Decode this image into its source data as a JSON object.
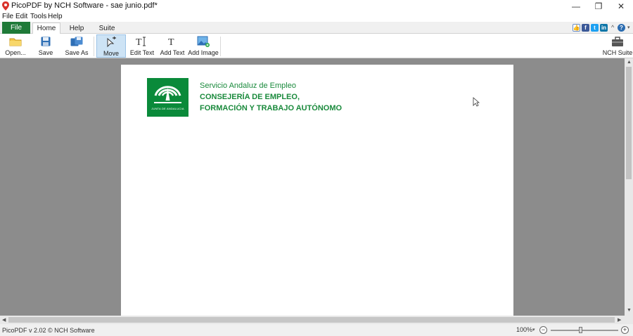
{
  "window": {
    "title": "PicoPDF by NCH Software - sae junio.pdf*"
  },
  "window_controls": {
    "minimize": "—",
    "restore": "❐",
    "close": "✕"
  },
  "menu": [
    "File",
    "Edit",
    "Tools",
    "Help"
  ],
  "tabs": [
    "File",
    "Home",
    "Help",
    "Suite"
  ],
  "toolbar": {
    "open": "Open...",
    "save": "Save",
    "save_as": "Save As",
    "move": "Move",
    "edit_text": "Edit Text",
    "add_text": "Add Text",
    "add_image": "Add Image",
    "nch_suite": "NCH Suite"
  },
  "social_icons": [
    "thumbs-up-icon",
    "facebook-icon",
    "twitter-icon",
    "linkedin-icon"
  ],
  "document": {
    "logo_caption": "JUNTA DE ANDALUCIA",
    "org_line1": "Servicio Andaluz de Empleo",
    "org_line2": "CONSEJERÍA DE EMPLEO,",
    "org_line3": "FORMACIÓN Y TRABAJO AUTÓNOMO"
  },
  "status": {
    "text": "PicoPDF v 2.02 © NCH Software",
    "zoom": "100%",
    "zoom_percent": 100
  },
  "colors": {
    "file_tab": "#1f7a38",
    "brand_green": "#0a8a3a",
    "workspace": "#8c8c8c",
    "active_button": "#cde3f5"
  }
}
